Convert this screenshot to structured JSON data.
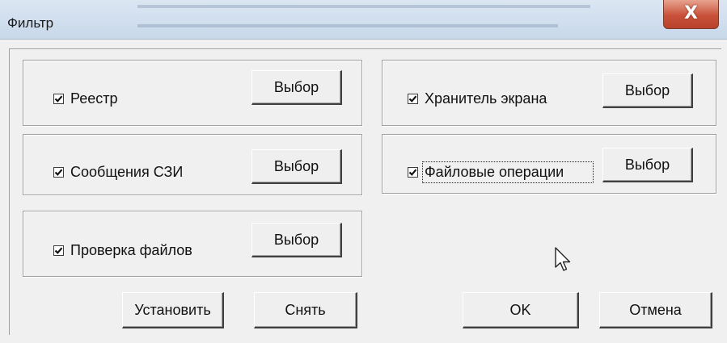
{
  "window": {
    "title": "Фильтр",
    "close_glyph": "X",
    "close_icon": "close-icon"
  },
  "groups": [
    {
      "label": "Реестр",
      "checked": true,
      "button": "Выбор"
    },
    {
      "label": "Сообщения СЗИ",
      "checked": true,
      "button": "Выбор"
    },
    {
      "label": "Проверка файлов",
      "checked": true,
      "button": "Выбор"
    },
    {
      "label": "Хранитель экрана",
      "checked": true,
      "button": "Выбор"
    },
    {
      "label": "Файловые операции",
      "checked": true,
      "button": "Выбор"
    }
  ],
  "footer": {
    "set_label": "Установить",
    "clear_label": "Снять",
    "ok_label": "OK",
    "cancel_label": "Отмена"
  },
  "cursor_icon": "mouse-pointer-icon"
}
